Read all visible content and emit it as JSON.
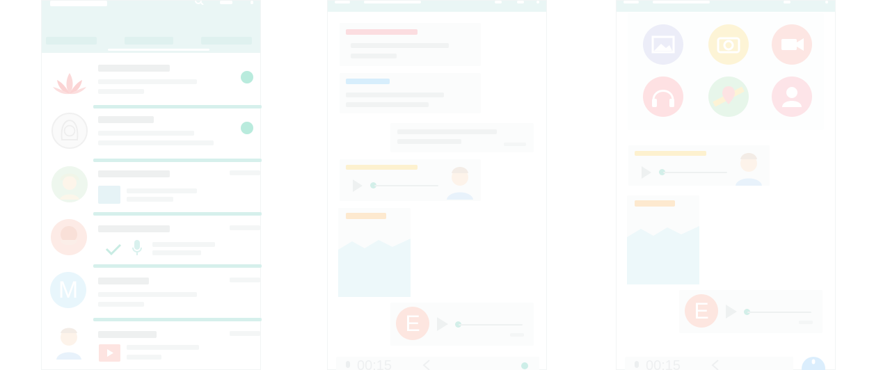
{
  "colors": {
    "header_bg": "#eaf6f5",
    "accent_teal": "#d6f0ec",
    "unread_dot": "#b9ebdd",
    "placeholder": "#eef0f0",
    "red_label": "#fbdde0",
    "blue_label": "#d7eefc",
    "yellow_label": "#fdf1cf",
    "orange_label": "#fde9cf",
    "attach_gallery": "#ecedf8",
    "attach_camera": "#fdf4d6",
    "attach_video": "#fde6e3",
    "attach_audio": "#fee1e3",
    "attach_location": "#e7f6ea",
    "attach_contact": "#fde4e8"
  },
  "chat_list": {
    "avatars": [
      {
        "icon": "lotus-icon"
      },
      {
        "icon": "woman-avatar-icon"
      },
      {
        "icon": "girl-avatar-icon"
      },
      {
        "icon": "boy-avatar-icon"
      },
      {
        "icon": "letter-avatar-icon",
        "letter": "M"
      },
      {
        "icon": "man-avatar-icon"
      }
    ]
  },
  "chat": {
    "voice_avatar_letter": "E",
    "record_time": "00:15"
  },
  "attachments": [
    {
      "icon": "gallery-icon",
      "color": "#ecedf8"
    },
    {
      "icon": "camera-icon",
      "color": "#fdf4d6"
    },
    {
      "icon": "video-icon",
      "color": "#fde6e3"
    },
    {
      "icon": "headphones-icon",
      "color": "#fee1e3"
    },
    {
      "icon": "location-icon",
      "color": "#e7f6ea"
    },
    {
      "icon": "contact-icon",
      "color": "#fde4e8"
    }
  ]
}
